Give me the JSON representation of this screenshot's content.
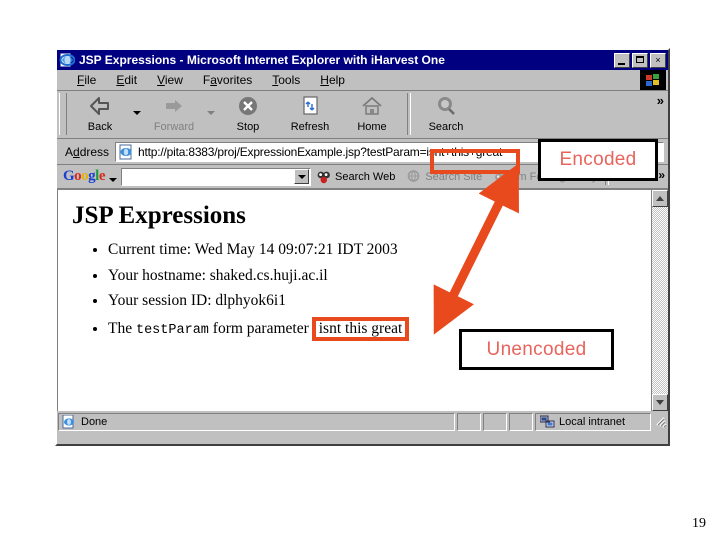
{
  "window": {
    "title": "JSP Expressions - Microsoft Internet Explorer with iHarvest One",
    "icon": "ie-document-icon",
    "buttons": {
      "minimize": "minimize-button",
      "maximize": "maximize-button",
      "close": "close-button",
      "close_glyph": "×"
    }
  },
  "menubar": {
    "items": [
      {
        "label": "File",
        "accel": "F"
      },
      {
        "label": "Edit",
        "accel": "E"
      },
      {
        "label": "View",
        "accel": "V"
      },
      {
        "label": "Favorites",
        "accel": "a"
      },
      {
        "label": "Tools",
        "accel": "T"
      },
      {
        "label": "Help",
        "accel": "H"
      }
    ],
    "brand_icon": "windows-flag-icon"
  },
  "toolbar": {
    "buttons": [
      {
        "label": "Back",
        "icon": "back-arrow-icon",
        "disabled": false,
        "dropdown": true
      },
      {
        "label": "Forward",
        "icon": "forward-arrow-icon",
        "disabled": true,
        "dropdown": true
      },
      {
        "label": "Stop",
        "icon": "stop-icon",
        "disabled": false,
        "dropdown": false
      },
      {
        "label": "Refresh",
        "icon": "refresh-icon",
        "disabled": false,
        "dropdown": false
      },
      {
        "label": "Home",
        "icon": "home-icon",
        "disabled": false,
        "dropdown": false
      },
      {
        "label": "Search",
        "icon": "search-icon",
        "disabled": false,
        "dropdown": false
      }
    ],
    "overflow": "»"
  },
  "address": {
    "label": "Address",
    "label_accel": "d",
    "icon": "page-icon",
    "url": "http://pita:8383/proj/ExpressionExample.jsp?testParam=isnt+this+great"
  },
  "googlebar": {
    "logo": {
      "g1": "G",
      "o1": "o",
      "o2": "o",
      "g2": "g",
      "l": "l",
      "e": "e"
    },
    "search_value": "",
    "buttons": [
      {
        "label": "Search Web",
        "icon": "google-web-icon",
        "disabled": false
      },
      {
        "label": "Search Site",
        "icon": "google-site-icon",
        "disabled": true
      },
      {
        "label": "I'm Feeling Lucky",
        "icon": "google-lucky-icon",
        "disabled": true
      }
    ],
    "overflow": "»"
  },
  "page": {
    "heading": "JSP Expressions",
    "bullets": [
      {
        "text": "Current time: Wed May 14 09:07:21 IDT 2003"
      },
      {
        "text": "Your hostname: shaked.cs.huji.ac.il"
      },
      {
        "text": "Your session ID: dlphyok6i1"
      }
    ],
    "param_bullet": {
      "prefix": "The ",
      "code": "testParam",
      "suffix": " form parameter",
      "value": "isnt this great"
    }
  },
  "statusbar": {
    "status_text": "Done",
    "status_icon": "ie-document-icon",
    "zone_text": "Local intranet",
    "zone_icon": "network-zone-icon"
  },
  "annotations": {
    "encoded_label": "Encoded",
    "unencoded_label": "Unencoded",
    "highlight_color": "#e8491d",
    "label_text_color": "#e8645c",
    "arrow_color": "#e8491d"
  },
  "slide": {
    "number": "19"
  }
}
